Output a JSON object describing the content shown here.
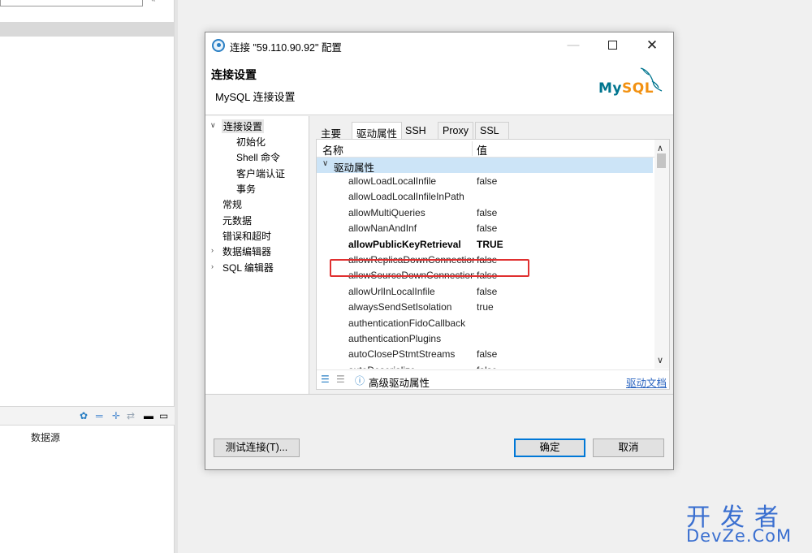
{
  "background": {
    "panel_column": "数据源"
  },
  "dialog": {
    "title": "连接 \"59.110.90.92\" 配置",
    "controls": {
      "minimize": "—",
      "maximize": "",
      "close": "✕"
    },
    "header": {
      "title": "连接设置",
      "subtitle": "MySQL 连接设置",
      "logo_my": "My",
      "logo_sql": "SQL"
    },
    "nav": [
      {
        "label": "连接设置",
        "expanded": true,
        "selected": true
      },
      {
        "label": "初始化",
        "child": true
      },
      {
        "label": "Shell 命令",
        "child": true
      },
      {
        "label": "客户端认证",
        "child": true
      },
      {
        "label": "事务",
        "child": true
      },
      {
        "label": "常规"
      },
      {
        "label": "元数据"
      },
      {
        "label": "错误和超时"
      },
      {
        "label": "数据编辑器",
        "collapsed": true
      },
      {
        "label": "SQL 编辑器",
        "collapsed": true
      }
    ],
    "tabs": [
      "主要",
      "驱动属性",
      "SSH",
      "Proxy",
      "SSL"
    ],
    "active_tab": "驱动属性",
    "grid": {
      "col_name": "名称",
      "col_value": "值",
      "group": "驱动属性",
      "rows": [
        {
          "name": "allowLoadLocalInfile",
          "value": "false"
        },
        {
          "name": "allowLoadLocalInfileInPath",
          "value": ""
        },
        {
          "name": "allowMultiQueries",
          "value": "false"
        },
        {
          "name": "allowNanAndInf",
          "value": "false"
        },
        {
          "name": "allowPublicKeyRetrieval",
          "value": "TRUE",
          "bold": true
        },
        {
          "name": "allowReplicaDownConnections",
          "value": "false"
        },
        {
          "name": "allowSourceDownConnections",
          "value": "false"
        },
        {
          "name": "allowUrlInLocalInfile",
          "value": "false"
        },
        {
          "name": "alwaysSendSetIsolation",
          "value": "true"
        },
        {
          "name": "authenticationFidoCallback",
          "value": ""
        },
        {
          "name": "authenticationPlugins",
          "value": ""
        },
        {
          "name": "autoClosePStmtStreams",
          "value": "false"
        },
        {
          "name": "autoDeserialize",
          "value": "false"
        }
      ]
    },
    "panel_toolbar": {
      "advanced_label": "高级驱动属性",
      "doc_link": "驱动文档"
    },
    "buttons": {
      "test": "测试连接(T)...",
      "ok": "确定",
      "cancel": "取消"
    },
    "colors": {
      "highlight_border": "#e03030",
      "selection": "#cce4f7",
      "link": "#2a64c0"
    }
  },
  "watermark": {
    "line1": "开发者",
    "line2": "DevZe.CoM"
  }
}
